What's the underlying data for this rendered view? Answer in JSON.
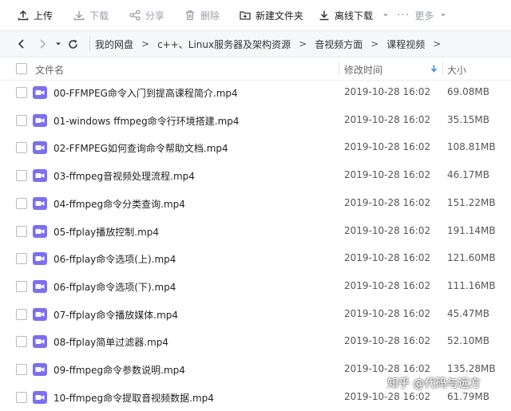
{
  "toolbar": {
    "upload": "上传",
    "download": "下载",
    "share": "分享",
    "delete": "删除",
    "new_folder": "新建文件夹",
    "offline_download": "离线下载",
    "more": "更多"
  },
  "nav": {
    "breadcrumbs": [
      "我的网盘",
      "c++、Linux服务器及架构资源",
      "音视频方面",
      "课程视频"
    ]
  },
  "columns": {
    "name": "文件名",
    "modified": "修改时间",
    "size": "大小"
  },
  "files": [
    {
      "name": "00-FFMPEG命令入门到提高课程简介.mp4",
      "time": "2019-10-28 16:02",
      "size": "69.08MB"
    },
    {
      "name": "01-windows ffmpeg命令行环境搭建.mp4",
      "time": "2019-10-28 16:02",
      "size": "35.15MB"
    },
    {
      "name": "02-FFMPEG如何查询命令帮助文档.mp4",
      "time": "2019-10-28 16:02",
      "size": "108.81MB"
    },
    {
      "name": "03-ffmpeg音视频处理流程.mp4",
      "time": "2019-10-28 16:02",
      "size": "46.17MB"
    },
    {
      "name": "04-ffmpeg命令分类查询.mp4",
      "time": "2019-10-28 16:02",
      "size": "151.22MB"
    },
    {
      "name": "05-ffplay播放控制.mp4",
      "time": "2019-10-28 16:02",
      "size": "191.14MB"
    },
    {
      "name": "06-ffplay命令选项(上).mp4",
      "time": "2019-10-28 16:02",
      "size": "121.60MB"
    },
    {
      "name": "06-ffplay命令选项(下).mp4",
      "time": "2019-10-28 16:02",
      "size": "111.16MB"
    },
    {
      "name": "07-ffplay命令播放媒体.mp4",
      "time": "2019-10-28 16:02",
      "size": "45.47MB"
    },
    {
      "name": "08-ffplay简单过滤器.mp4",
      "time": "2019-10-28 16:02",
      "size": "52.10MB"
    },
    {
      "name": "09-ffmpeg命令参数说明.mp4",
      "time": "2019-10-28 16:02",
      "size": "135.28MB"
    },
    {
      "name": "10-ffmpeg命令提取音视频数据.mp4",
      "time": "2019-10-28 16:02",
      "size": "61.79MB"
    }
  ],
  "watermark": "知乎 @代码与远方",
  "colors": {
    "video_icon": "#7b6ff0",
    "sort_arrow": "#2e8cf0",
    "header_bg": "#f6f7f9"
  }
}
